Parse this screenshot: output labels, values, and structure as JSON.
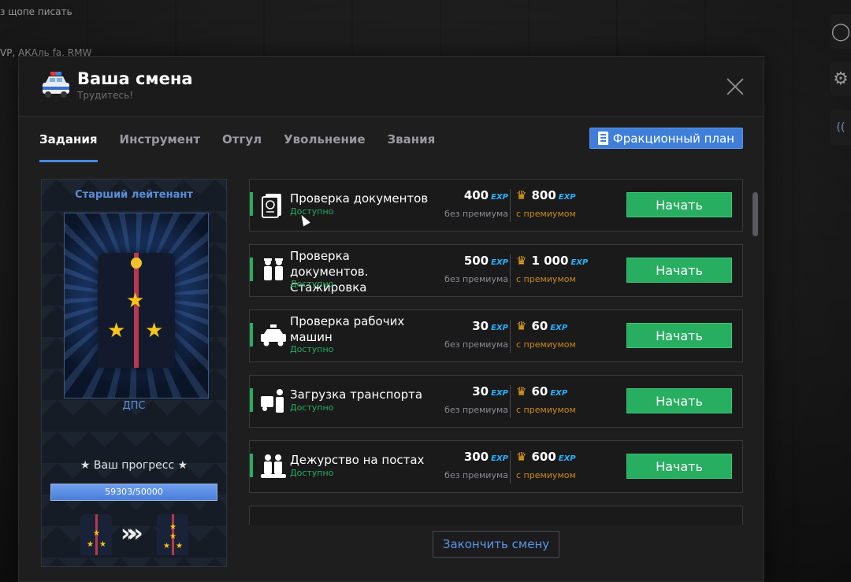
{
  "background": {
    "chat_line_1": "з щопе писать",
    "chat_line_2": "VP, АКАль fa, RMW"
  },
  "modal": {
    "title": "Ваша смена",
    "subtitle": "Трудитесь!",
    "header_icon": "police-car-icon",
    "close_icon": "close-icon"
  },
  "tabs": [
    {
      "label": "Задания",
      "active": true
    },
    {
      "label": "Инструмент",
      "active": false
    },
    {
      "label": "Отгул",
      "active": false
    },
    {
      "label": "Увольнение",
      "active": false
    },
    {
      "label": "Звания",
      "active": false
    }
  ],
  "faction_button": {
    "label": "Фракционный план",
    "icon": "document-icon"
  },
  "rank": {
    "title": "Старший лейтенант",
    "organization": "ДПС",
    "progress_label": "★ Ваш прогресс ★",
    "progress_text": "59303/50000",
    "progress_fraction": 1.0
  },
  "tasks": [
    {
      "name": "Проверка документов",
      "status": "Доступно",
      "exp": "400",
      "exp_premium": "800",
      "icon": "passport-icon"
    },
    {
      "name": "Проверка документов. Стажировка",
      "status": "Доступно",
      "exp": "500",
      "exp_premium": "1 000",
      "icon": "officers-icon"
    },
    {
      "name": "Проверка рабочих машин",
      "status": "Доступно",
      "exp": "30",
      "exp_premium": "60",
      "icon": "police-car-icon"
    },
    {
      "name": "Загрузка транспорта",
      "status": "Доступно",
      "exp": "30",
      "exp_premium": "60",
      "icon": "officer-car-icon"
    },
    {
      "name": "Дежурство на постах",
      "status": "Доступно",
      "exp": "300",
      "exp_premium": "600",
      "icon": "patrol-icon"
    }
  ],
  "labels": {
    "exp_tag": "EXP",
    "without_premium": "без премиума",
    "with_premium": "с премиумом",
    "start": "Начать"
  },
  "finish_button": "Закончить смену",
  "colors": {
    "accent_blue": "#3f7fd9",
    "start_green": "#27ae60",
    "status_green": "#27ae60",
    "exp_blue": "#26b3ff",
    "premium_gold": "#f0a91c"
  }
}
